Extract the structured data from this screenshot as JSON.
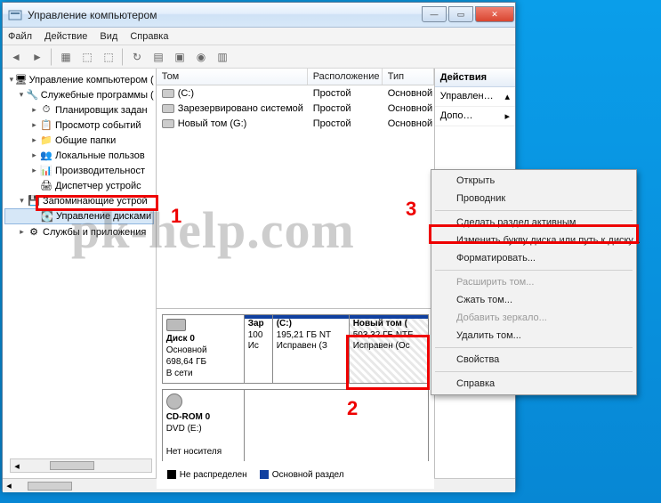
{
  "window": {
    "title": "Управление компьютером"
  },
  "menu": {
    "file": "Файл",
    "action": "Действие",
    "view": "Вид",
    "help": "Справка"
  },
  "tree": {
    "root": "Управление компьютером (",
    "sys_tools": "Служебные программы (",
    "task_sched": "Планировщик задан",
    "event_viewer": "Просмотр событий",
    "shared": "Общие папки",
    "users": "Локальные пользов",
    "perf": "Производительност",
    "devmgr": "Диспетчер устройс",
    "storage": "Запоминающие устрой",
    "diskmgmt": "Управление дисками",
    "services": "Службы и приложения"
  },
  "cols": {
    "vol": "Том",
    "layout": "Расположение",
    "type": "Тип"
  },
  "vols": [
    {
      "name": "(C:)",
      "layout": "Простой",
      "type": "Основной"
    },
    {
      "name": "Зарезервировано системой",
      "layout": "Простой",
      "type": "Основной"
    },
    {
      "name": "Новый том (G:)",
      "layout": "Простой",
      "type": "Основной"
    }
  ],
  "actions": {
    "header": "Действия",
    "item1": "Управлен…",
    "item2": "Допо…"
  },
  "disk0": {
    "name": "Диск 0",
    "type": "Основной",
    "size": "698,64 ГБ",
    "status": "В сети",
    "p1": {
      "title": "Зар",
      "size": "100",
      "status": "Ис"
    },
    "p2": {
      "title": "(C:)",
      "size": "195,21 ГБ NT",
      "status": "Исправен (З"
    },
    "p3": {
      "title": "Новый том (",
      "size": "503,32 ГБ NTF",
      "status": "Исправен (Ос"
    }
  },
  "cdrom": {
    "name": "CD-ROM 0",
    "line2": "DVD (E:)",
    "status": "Нет носителя"
  },
  "legend": {
    "unalloc": "Не распределен",
    "primary": "Основной раздел"
  },
  "ctx": {
    "open": "Открыть",
    "explorer": "Проводник",
    "active": "Сделать раздел активным",
    "change_letter": "Изменить букву диска или путь к диску...",
    "format": "Форматировать...",
    "extend": "Расширить том...",
    "shrink": "Сжать том...",
    "mirror": "Добавить зеркало...",
    "delete": "Удалить том...",
    "props": "Свойства",
    "help": "Справка"
  },
  "watermark": "pk-help.com",
  "annot": {
    "n1": "1",
    "n2": "2",
    "n3": "3"
  }
}
